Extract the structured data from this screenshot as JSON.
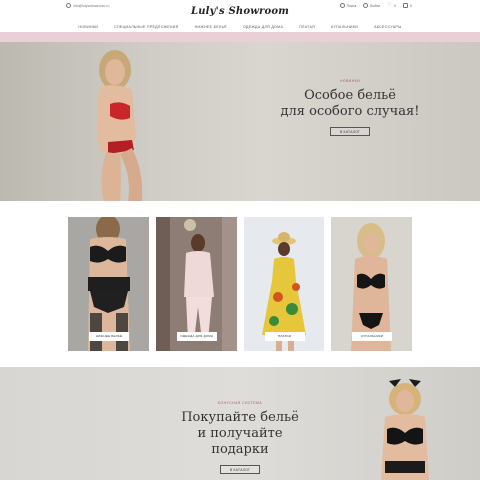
{
  "header": {
    "contact": "info@lulysshowroom.ru",
    "logo": "Luly's Showroom",
    "tools": {
      "search": "Поиск",
      "login": "Войти",
      "wishlist_count": "0",
      "cart_count": "0"
    }
  },
  "nav": {
    "items": [
      "Новинки",
      "Специальные предложения",
      "Нижнее бельё",
      "Одежда для дома",
      "Платья",
      "Купальники",
      "Аксессуары"
    ]
  },
  "hero": {
    "eyebrow": "Новинки",
    "title_line1": "Особое бельё",
    "title_line2": "для особого случая!",
    "button": "В каталог"
  },
  "categories": [
    {
      "label": "Нижнее бельё"
    },
    {
      "label": "Одежда для дома"
    },
    {
      "label": "Платья"
    },
    {
      "label": "Купальники"
    }
  ],
  "promo": {
    "eyebrow": "Бонусная система",
    "title_line1": "Покупайте бельё",
    "title_line2": "и получайте подарки",
    "button": "В каталог"
  },
  "colors": {
    "accent_pink": "#e9cfd6",
    "eyebrow": "#a0607a",
    "hero_bg": "#cfccc5"
  }
}
